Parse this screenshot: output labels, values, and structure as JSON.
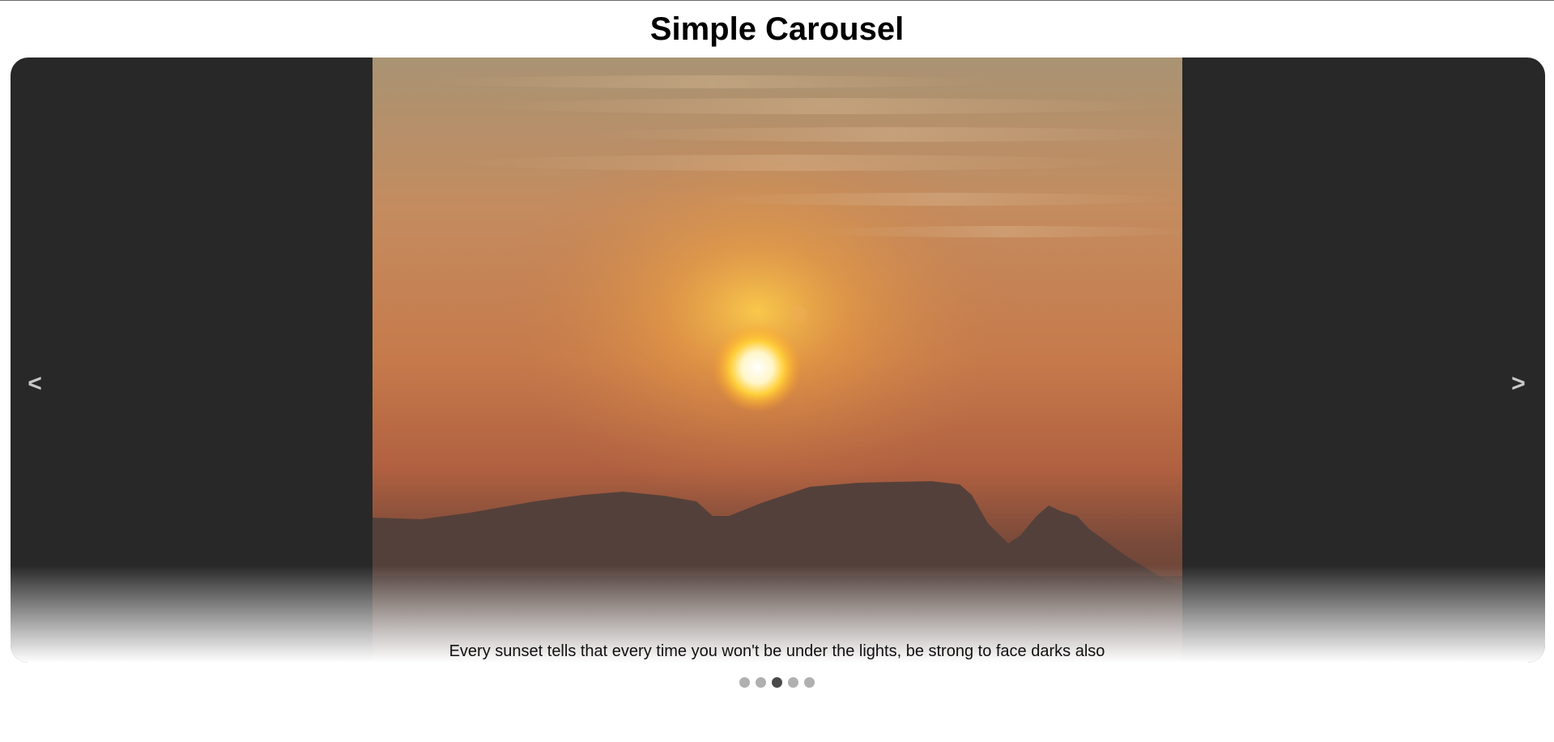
{
  "page": {
    "title": "Simple Carousel"
  },
  "carousel": {
    "prev_label": "<",
    "next_label": ">",
    "caption": "Every sunset tells that every time you won't be under the lights, be strong to face darks also",
    "slide_image": "sunset-over-mountains",
    "slide_count": 5,
    "active_index": 2,
    "colors": {
      "frame": "#282828",
      "dot": "#b0b0b0",
      "dot_active": "#4a4a4a"
    }
  }
}
